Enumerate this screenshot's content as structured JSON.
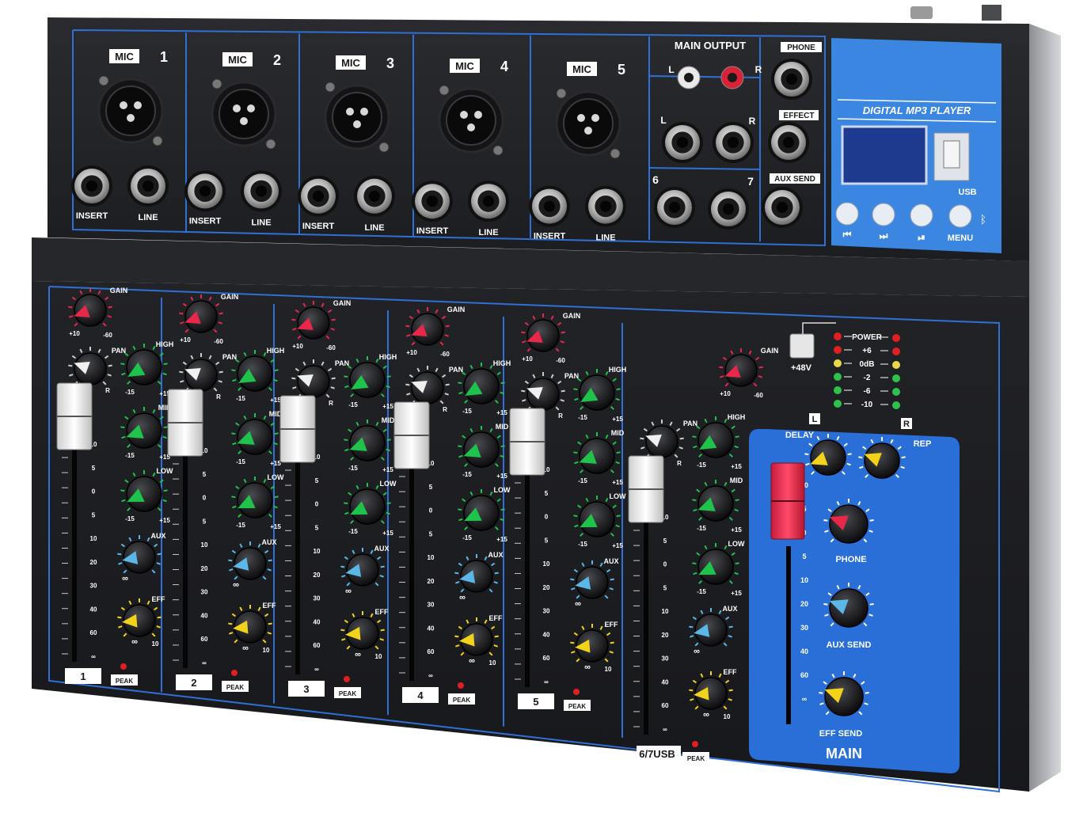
{
  "inputs": {
    "channels": [
      {
        "mic": "MIC",
        "num": "1",
        "insert": "INSERT",
        "line": "LINE"
      },
      {
        "mic": "MIC",
        "num": "2",
        "insert": "INSERT",
        "line": "LINE"
      },
      {
        "mic": "MIC",
        "num": "3",
        "insert": "INSERT",
        "line": "LINE"
      },
      {
        "mic": "MIC",
        "num": "4",
        "insert": "INSERT",
        "line": "LINE"
      },
      {
        "mic": "MIC",
        "num": "5",
        "insert": "INSERT",
        "line": "LINE"
      }
    ],
    "main_output": "MAIN OUTPUT",
    "left": "L",
    "right": "R",
    "ch6": "6",
    "ch7": "7",
    "phone": "PHONE",
    "effect": "EFFECT",
    "aux_send": "AUX SEND"
  },
  "mp3": {
    "title": "DIGITAL MP3 PLAYER",
    "usb": "USB",
    "menu": "MENU",
    "buttons": [
      "prev-icon",
      "next-icon",
      "play-pause-icon",
      "menu-button",
      "bluetooth-icon"
    ]
  },
  "strip_labels": {
    "gain": "GAIN",
    "pan": "PAN",
    "high": "HIGH",
    "mid": "MID",
    "low": "LOW",
    "aux": "AUX",
    "eff": "EFF",
    "peak": "PEAK",
    "plus10": "+10",
    "minus60": "-60",
    "minus15": "-15",
    "plus15": "+15",
    "l": "L",
    "r": "R",
    "inf": "∞",
    "ten": "10"
  },
  "fader_scale": [
    "10",
    "5",
    "0",
    "5",
    "10",
    "20",
    "30",
    "40",
    "60",
    "∞"
  ],
  "channel_labels": [
    "1",
    "2",
    "3",
    "4",
    "5",
    "6/7USB"
  ],
  "master": {
    "phantom": "+48V",
    "meter": [
      {
        "label": "POWER",
        "color": "#e02020"
      },
      {
        "label": "+6",
        "color": "#e02020"
      },
      {
        "label": "0dB",
        "color": "#e8d84a"
      },
      {
        "label": "-2",
        "color": "#2ec24a"
      },
      {
        "label": "-6",
        "color": "#2ec24a"
      },
      {
        "label": "-10",
        "color": "#2ec24a"
      }
    ],
    "l": "L",
    "r": "R",
    "delay": "DELAY",
    "rep": "REP",
    "phone": "PHONE",
    "aux_send": "AUX SEND",
    "eff_send": "EFF SEND",
    "main": "MAIN"
  },
  "colors": {
    "chassis": "#1b1c1f",
    "panel_line": "#2f6fd6",
    "master_panel": "#2a6fd8",
    "mp3_panel": "#3a86e0",
    "gain_pointer": "#e8284a",
    "eq_pointer": "#1fc24a",
    "aux_pointer": "#5ab7e8",
    "eff_pointer": "#f2d21b",
    "fader_cap": "#e8e8e8",
    "master_cap": "#e8284a"
  }
}
